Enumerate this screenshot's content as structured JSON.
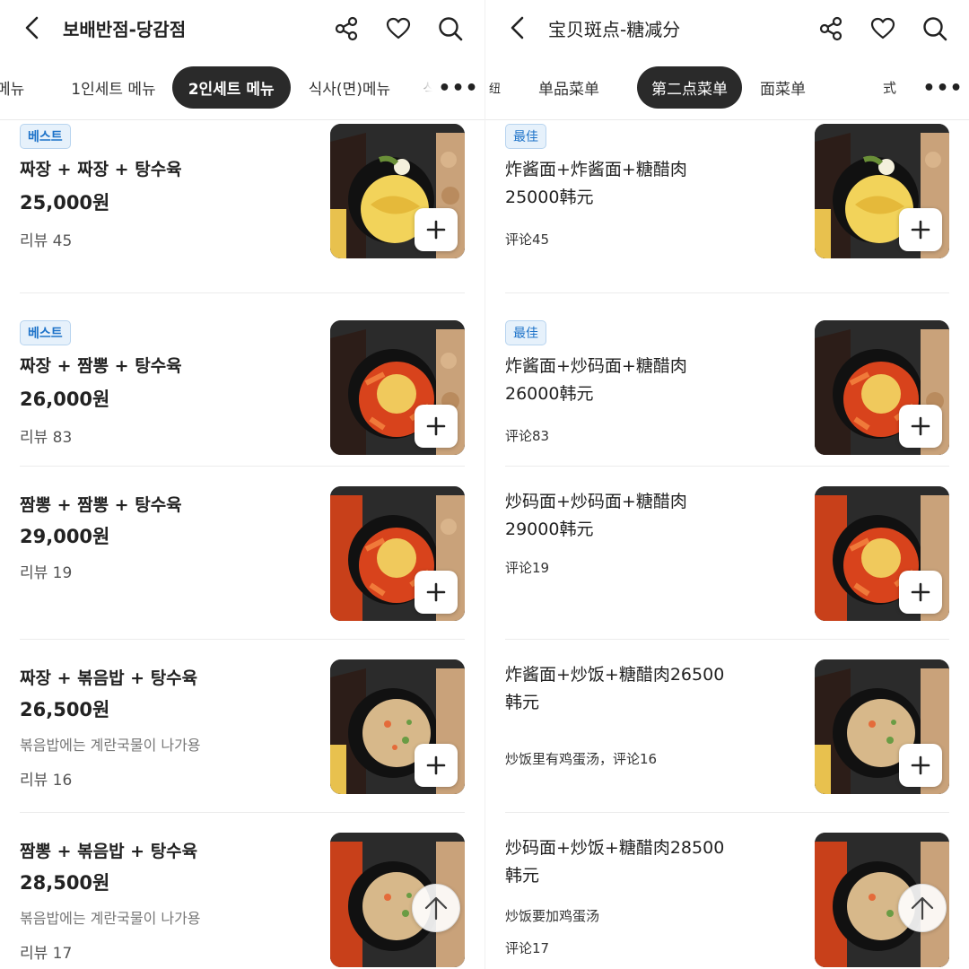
{
  "left": {
    "title": "보배반점-당감점",
    "tabs": [
      {
        "label": "메뉴"
      },
      {
        "label": "1인세트 메뉴"
      },
      {
        "label": "2인세트 메뉴"
      },
      {
        "label": "식사(면)메뉴"
      },
      {
        "label": "식"
      }
    ],
    "more_label": "•••",
    "items": [
      {
        "badge": "베스트",
        "name": "짜장 + 짜장 + 탕수육",
        "price": "25,000원",
        "note": "",
        "review": "리뷰 45"
      },
      {
        "badge": "베스트",
        "name": "짜장 + 짬뽕 + 탕수육",
        "price": "26,000원",
        "note": "",
        "review": "리뷰 83"
      },
      {
        "badge": "",
        "name": "짬뽕 + 짬뽕 + 탕수육",
        "price": "29,000원",
        "note": "",
        "review": "리뷰 19"
      },
      {
        "badge": "",
        "name": "짜장 + 볶음밥 + 탕수육",
        "price": "26,500원",
        "note": "볶음밥에는 계란국물이 나가용",
        "review": "리뷰 16"
      },
      {
        "badge": "",
        "name": "짬뽕 + 볶음밥 + 탕수육",
        "price": "28,500원",
        "note": "볶음밥에는 계란국물이 나가용",
        "review": "리뷰 17"
      }
    ]
  },
  "right": {
    "title": "宝贝斑点-糖减分",
    "tabs": [
      {
        "label": "纽"
      },
      {
        "label": "单品菜单"
      },
      {
        "label": "第二点菜单"
      },
      {
        "label": "面菜单"
      },
      {
        "label": "式"
      }
    ],
    "more_label": "•••",
    "items": [
      {
        "badge": "最佳",
        "name": "炸酱面+炸酱面+糖醋肉25000韩元",
        "note": "",
        "review": "评论45"
      },
      {
        "badge": "最佳",
        "name": "炸酱面+炒码面+糖醋肉26000韩元",
        "note": "",
        "review": "评论83"
      },
      {
        "badge": "",
        "name": "炒码面+炒码面+糖醋肉29000韩元",
        "note": "",
        "review": "评论19"
      },
      {
        "badge": "",
        "name": "炸酱面+炒饭+糖醋肉26500韩元",
        "note": "炒饭里有鸡蛋汤，评论16",
        "review": ""
      },
      {
        "badge": "",
        "name": "炒码面+炒饭+糖醋肉28500韩元",
        "note": "炒饭要加鸡蛋汤",
        "review": "评论17"
      }
    ]
  },
  "icons": {
    "back": "chevron-left-icon",
    "share": "share-icon",
    "favorite": "heart-icon",
    "search": "search-icon",
    "add": "plus-icon",
    "scroll_top": "arrow-up-icon"
  },
  "colors": {
    "active_tab_bg": "#2a2a2a",
    "badge_text": "#1e73c9",
    "badge_bg": "#e6f1fb"
  }
}
